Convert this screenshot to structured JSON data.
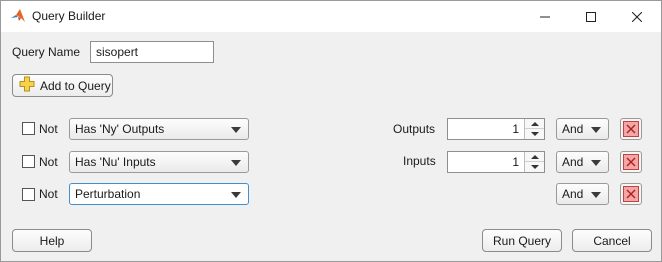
{
  "window": {
    "title": "Query Builder"
  },
  "query_name": {
    "label": "Query Name",
    "value": "sisopert"
  },
  "add_button": {
    "label": "Add to Query"
  },
  "rows": [
    {
      "not_label": "Not",
      "not_checked": false,
      "condition": "Has 'Ny' Outputs",
      "param_label": "Outputs",
      "param_value": "1",
      "logic": "And"
    },
    {
      "not_label": "Not",
      "not_checked": false,
      "condition": "Has 'Nu' Inputs",
      "param_label": "Inputs",
      "param_value": "1",
      "logic": "And"
    },
    {
      "not_label": "Not",
      "not_checked": false,
      "condition": "Perturbation",
      "logic": "And"
    }
  ],
  "footer": {
    "help": "Help",
    "run": "Run Query",
    "cancel": "Cancel"
  },
  "colors": {
    "remove_fill": "#f3a6a6",
    "remove_stroke": "#c24040",
    "focus_border": "#3e8fd4"
  },
  "icons": {
    "app": "matlab-logo-icon",
    "add": "plus-icon",
    "remove": "close-icon"
  }
}
